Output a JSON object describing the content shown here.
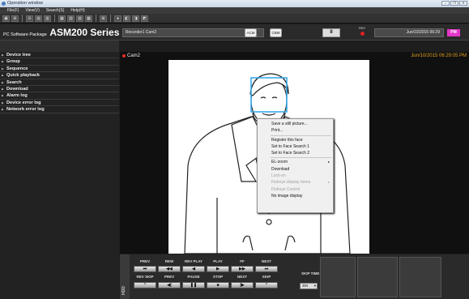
{
  "window": {
    "title": "Operation window",
    "controls": [
      "–",
      "❐",
      "✕"
    ]
  },
  "menubar": [
    "File(F)",
    "View(V)",
    "Search(S)",
    "Help(H)"
  ],
  "toolbar": {
    "buttons": [
      "▣",
      "⊞",
      "⊟",
      "▤",
      "▥",
      "▦",
      "▧",
      "▨",
      "▩",
      "⊠",
      "●",
      "◧",
      "◨",
      "◩"
    ]
  },
  "header": {
    "package_label": "PC Software Package",
    "product": "ASM200 Series",
    "recorder_field": "Recorder1 Cam2",
    "btn_acm": "ACM",
    "btn_cbm": "CBM",
    "pause": "II",
    "rec_label": "REC",
    "datetime": "Jun/10/2015 06:29",
    "pm": "PM"
  },
  "sidebar": {
    "items": [
      "Device tree",
      "Group",
      "Sequence",
      "Quick playback",
      "Search",
      "Download",
      "Alarm log",
      "Device error log",
      "Network error log"
    ]
  },
  "video": {
    "camera": "Cam2",
    "timestamp": "Jun/10/2015 06:29:05 PM"
  },
  "context_menu": {
    "items": [
      {
        "label": "Save a still picture...",
        "disabled": false
      },
      {
        "label": "Print...",
        "disabled": false
      },
      {
        "sep": true
      },
      {
        "label": "Register this face",
        "disabled": false
      },
      {
        "label": "Set to Face Search 1",
        "disabled": false
      },
      {
        "label": "Set to Face Search 2",
        "disabled": false
      },
      {
        "sep": true
      },
      {
        "label": "EL-zoom",
        "disabled": false,
        "submenu": true
      },
      {
        "label": "Download",
        "disabled": false
      },
      {
        "label": "Lock-on",
        "disabled": true
      },
      {
        "label": "Fisheye display menu",
        "disabled": true,
        "submenu": true
      },
      {
        "label": "Fisheye Control",
        "disabled": true
      },
      {
        "label": "No image display",
        "disabled": false
      }
    ]
  },
  "controls": {
    "hdd": "HDD",
    "top_labels": [
      "PREV",
      "REW",
      "REV PLAY",
      "PLAY",
      "FF",
      "NEXT"
    ],
    "top_icons": [
      "⏮",
      "◀◀",
      "◀",
      "▶",
      "▶▶",
      "⏭"
    ],
    "bottom_labels": [
      "REV SKIP",
      "PREV",
      "PAUSE",
      "STOP",
      "NEXT",
      "SKIP"
    ],
    "bottom_icons": [
      "⌃",
      "◀|",
      "❚❚",
      "■",
      "|▶",
      "⌃"
    ],
    "skip_time_label": "SKIP TIME",
    "skip_time_value": "30s"
  }
}
